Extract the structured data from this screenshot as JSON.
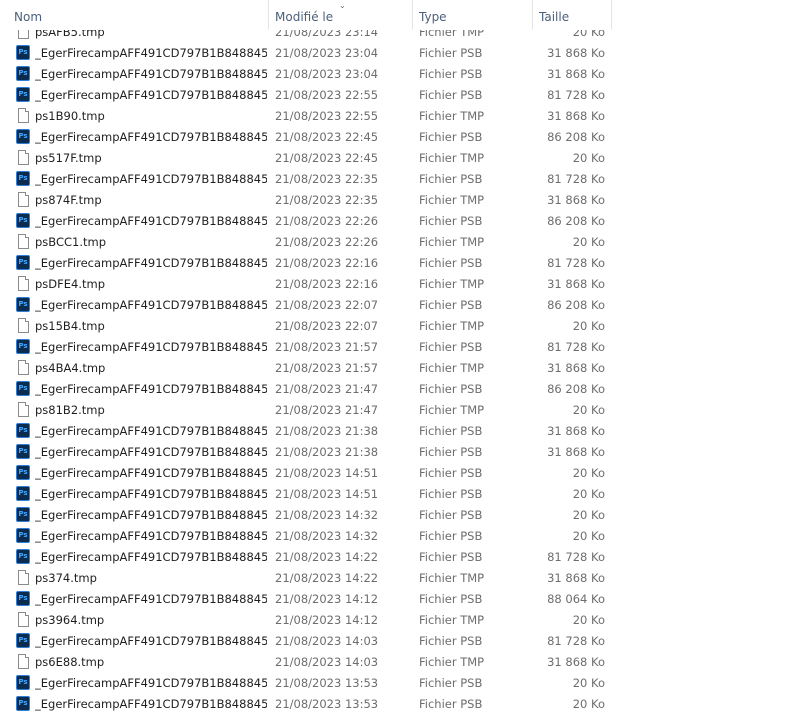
{
  "columns": {
    "name": "Nom",
    "modified": "Modifié le",
    "type": "Type",
    "size": "Taille"
  },
  "icon_text": {
    "psb": "Ps"
  },
  "files": [
    {
      "name": "psAFB5.tmp",
      "date": "21/08/2023 23:14",
      "type": "Fichier TMP",
      "size": "20 Ko",
      "kind": "tmp"
    },
    {
      "name": "_EgerFirecampAFF491CD797B1B8488459E...",
      "date": "21/08/2023 23:04",
      "type": "Fichier PSB",
      "size": "31 868 Ko",
      "kind": "psb"
    },
    {
      "name": "_EgerFirecampAFF491CD797B1B8488459E...",
      "date": "21/08/2023 23:04",
      "type": "Fichier PSB",
      "size": "31 868 Ko",
      "kind": "psb"
    },
    {
      "name": "_EgerFirecampAFF491CD797B1B8488459E...",
      "date": "21/08/2023 22:55",
      "type": "Fichier PSB",
      "size": "81 728 Ko",
      "kind": "psb"
    },
    {
      "name": "ps1B90.tmp",
      "date": "21/08/2023 22:55",
      "type": "Fichier TMP",
      "size": "31 868 Ko",
      "kind": "tmp"
    },
    {
      "name": "_EgerFirecampAFF491CD797B1B8488459E...",
      "date": "21/08/2023 22:45",
      "type": "Fichier PSB",
      "size": "86 208 Ko",
      "kind": "psb"
    },
    {
      "name": "ps517F.tmp",
      "date": "21/08/2023 22:45",
      "type": "Fichier TMP",
      "size": "20 Ko",
      "kind": "tmp"
    },
    {
      "name": "_EgerFirecampAFF491CD797B1B8488459E...",
      "date": "21/08/2023 22:35",
      "type": "Fichier PSB",
      "size": "81 728 Ko",
      "kind": "psb"
    },
    {
      "name": "ps874F.tmp",
      "date": "21/08/2023 22:35",
      "type": "Fichier TMP",
      "size": "31 868 Ko",
      "kind": "tmp"
    },
    {
      "name": "_EgerFirecampAFF491CD797B1B8488459E...",
      "date": "21/08/2023 22:26",
      "type": "Fichier PSB",
      "size": "86 208 Ko",
      "kind": "psb"
    },
    {
      "name": "psBCC1.tmp",
      "date": "21/08/2023 22:26",
      "type": "Fichier TMP",
      "size": "20 Ko",
      "kind": "tmp"
    },
    {
      "name": "_EgerFirecampAFF491CD797B1B8488459E...",
      "date": "21/08/2023 22:16",
      "type": "Fichier PSB",
      "size": "81 728 Ko",
      "kind": "psb"
    },
    {
      "name": "psDFE4.tmp",
      "date": "21/08/2023 22:16",
      "type": "Fichier TMP",
      "size": "31 868 Ko",
      "kind": "tmp"
    },
    {
      "name": "_EgerFirecampAFF491CD797B1B8488459E...",
      "date": "21/08/2023 22:07",
      "type": "Fichier PSB",
      "size": "86 208 Ko",
      "kind": "psb"
    },
    {
      "name": "ps15B4.tmp",
      "date": "21/08/2023 22:07",
      "type": "Fichier TMP",
      "size": "20 Ko",
      "kind": "tmp"
    },
    {
      "name": "_EgerFirecampAFF491CD797B1B8488459E...",
      "date": "21/08/2023 21:57",
      "type": "Fichier PSB",
      "size": "81 728 Ko",
      "kind": "psb"
    },
    {
      "name": "ps4BA4.tmp",
      "date": "21/08/2023 21:57",
      "type": "Fichier TMP",
      "size": "31 868 Ko",
      "kind": "tmp"
    },
    {
      "name": "_EgerFirecampAFF491CD797B1B8488459E...",
      "date": "21/08/2023 21:47",
      "type": "Fichier PSB",
      "size": "86 208 Ko",
      "kind": "psb"
    },
    {
      "name": "ps81B2.tmp",
      "date": "21/08/2023 21:47",
      "type": "Fichier TMP",
      "size": "20 Ko",
      "kind": "tmp"
    },
    {
      "name": "_EgerFirecampAFF491CD797B1B8488459E...",
      "date": "21/08/2023 21:38",
      "type": "Fichier PSB",
      "size": "31 868 Ko",
      "kind": "psb"
    },
    {
      "name": "_EgerFirecampAFF491CD797B1B8488459E...",
      "date": "21/08/2023 21:38",
      "type": "Fichier PSB",
      "size": "31 868 Ko",
      "kind": "psb"
    },
    {
      "name": "_EgerFirecampAFF491CD797B1B8488459E...",
      "date": "21/08/2023 14:51",
      "type": "Fichier PSB",
      "size": "20 Ko",
      "kind": "psb"
    },
    {
      "name": "_EgerFirecampAFF491CD797B1B8488459E...",
      "date": "21/08/2023 14:51",
      "type": "Fichier PSB",
      "size": "20 Ko",
      "kind": "psb"
    },
    {
      "name": "_EgerFirecampAFF491CD797B1B8488459E...",
      "date": "21/08/2023 14:32",
      "type": "Fichier PSB",
      "size": "20 Ko",
      "kind": "psb"
    },
    {
      "name": "_EgerFirecampAFF491CD797B1B8488459E...",
      "date": "21/08/2023 14:32",
      "type": "Fichier PSB",
      "size": "20 Ko",
      "kind": "psb"
    },
    {
      "name": "_EgerFirecampAFF491CD797B1B8488459E...",
      "date": "21/08/2023 14:22",
      "type": "Fichier PSB",
      "size": "81 728 Ko",
      "kind": "psb"
    },
    {
      "name": "ps374.tmp",
      "date": "21/08/2023 14:22",
      "type": "Fichier TMP",
      "size": "31 868 Ko",
      "kind": "tmp"
    },
    {
      "name": "_EgerFirecampAFF491CD797B1B8488459E...",
      "date": "21/08/2023 14:12",
      "type": "Fichier PSB",
      "size": "88 064 Ko",
      "kind": "psb"
    },
    {
      "name": "ps3964.tmp",
      "date": "21/08/2023 14:12",
      "type": "Fichier TMP",
      "size": "20 Ko",
      "kind": "tmp"
    },
    {
      "name": "_EgerFirecampAFF491CD797B1B8488459E...",
      "date": "21/08/2023 14:03",
      "type": "Fichier PSB",
      "size": "81 728 Ko",
      "kind": "psb"
    },
    {
      "name": "ps6E88.tmp",
      "date": "21/08/2023 14:03",
      "type": "Fichier TMP",
      "size": "31 868 Ko",
      "kind": "tmp"
    },
    {
      "name": "_EgerFirecampAFF491CD797B1B8488459E...",
      "date": "21/08/2023 13:53",
      "type": "Fichier PSB",
      "size": "20 Ko",
      "kind": "psb"
    },
    {
      "name": "_EgerFirecampAFF491CD797B1B8488459E...",
      "date": "21/08/2023 13:53",
      "type": "Fichier PSB",
      "size": "20 Ko",
      "kind": "psb"
    }
  ]
}
